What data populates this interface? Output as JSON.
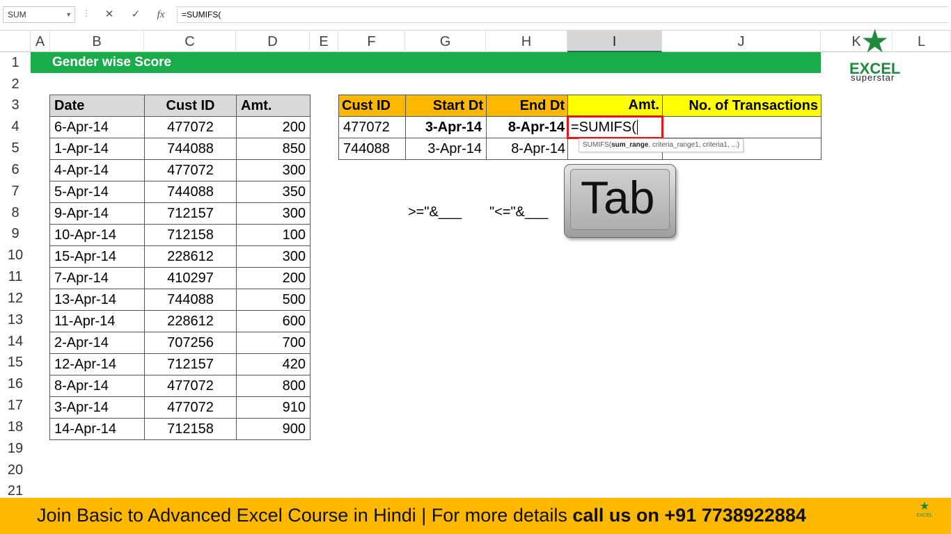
{
  "formula_bar": {
    "name_box": "SUM",
    "cancel_icon": "✕",
    "enter_icon": "✓",
    "fx_icon": "fx",
    "formula": "=SUMIFS("
  },
  "columns": [
    "A",
    "B",
    "C",
    "D",
    "E",
    "F",
    "G",
    "H",
    "I",
    "J",
    "K",
    "L"
  ],
  "rows": [
    "1",
    "2",
    "3",
    "4",
    "5",
    "6",
    "7",
    "8",
    "9",
    "10",
    "11",
    "12",
    "13",
    "14",
    "15",
    "16",
    "17",
    "18",
    "19",
    "20",
    "21"
  ],
  "sheet_title": "Gender wise Score",
  "logo": {
    "name": "EXCEL",
    "sub": "superstar"
  },
  "data_table": {
    "headers": [
      "Date",
      "Cust ID",
      "Amt."
    ],
    "rows": [
      [
        "6-Apr-14",
        "477072",
        "200"
      ],
      [
        "1-Apr-14",
        "744088",
        "850"
      ],
      [
        "4-Apr-14",
        "477072",
        "300"
      ],
      [
        "5-Apr-14",
        "744088",
        "350"
      ],
      [
        "9-Apr-14",
        "712157",
        "300"
      ],
      [
        "10-Apr-14",
        "712158",
        "100"
      ],
      [
        "15-Apr-14",
        "228612",
        "300"
      ],
      [
        "7-Apr-14",
        "410297",
        "200"
      ],
      [
        "13-Apr-14",
        "744088",
        "500"
      ],
      [
        "11-Apr-14",
        "228612",
        "600"
      ],
      [
        "2-Apr-14",
        "707256",
        "700"
      ],
      [
        "12-Apr-14",
        "712157",
        "420"
      ],
      [
        "8-Apr-14",
        "477072",
        "800"
      ],
      [
        "3-Apr-14",
        "477072",
        "910"
      ],
      [
        "14-Apr-14",
        "712158",
        "900"
      ]
    ]
  },
  "lookup_table": {
    "headers": [
      "Cust ID",
      "Start Dt",
      "End Dt",
      "Amt.",
      "No. of Transactions"
    ],
    "rows": [
      [
        "477072",
        "3-Apr-14",
        "8-Apr-14",
        "=SUMIFS(",
        ""
      ],
      [
        "744088",
        "3-Apr-14",
        "8-Apr-14",
        "",
        ""
      ]
    ]
  },
  "tooltip": {
    "prefix": "SUMIFS(",
    "bold_arg": "sum_range",
    "rest": ", criteria_range1, criteria1, ...)"
  },
  "hints": [
    ">=\"&___",
    "\"<=\"&___"
  ],
  "tab_key_label": "Tab",
  "banner": {
    "normal": "Join Basic to Advanced Excel Course in Hindi | For more details ",
    "bold": "call us on +91 7738922884",
    "logo_text": "EXCEL"
  },
  "colors": {
    "title_band": "#1aab4b",
    "header_orange": "#ffb800",
    "header_yellow": "#ffff00",
    "highlight_red": "#e0161d",
    "banner": "#ffb800"
  }
}
